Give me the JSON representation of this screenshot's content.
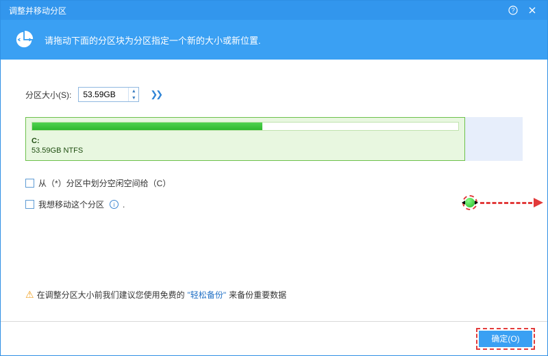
{
  "titlebar": {
    "title": "调整并移动分区"
  },
  "banner": {
    "text": "请拖动下面的分区块为分区指定一个新的大小或新位置."
  },
  "size": {
    "label": "分区大小(S):",
    "value": "53.59GB"
  },
  "partition": {
    "drive": "C:",
    "info": "53.59GB NTFS",
    "used_percent": 54
  },
  "options": {
    "allocate_free": "从（*）分区中划分空闲空间给（C）",
    "move_partition": "我想移动这个分区"
  },
  "warning": {
    "prefix": "在调整分区大小前我们建议您使用免费的 ",
    "link": "\"轻松备份\"",
    "suffix": " 来备份重要数据"
  },
  "footer": {
    "ok": "确定(O)"
  }
}
